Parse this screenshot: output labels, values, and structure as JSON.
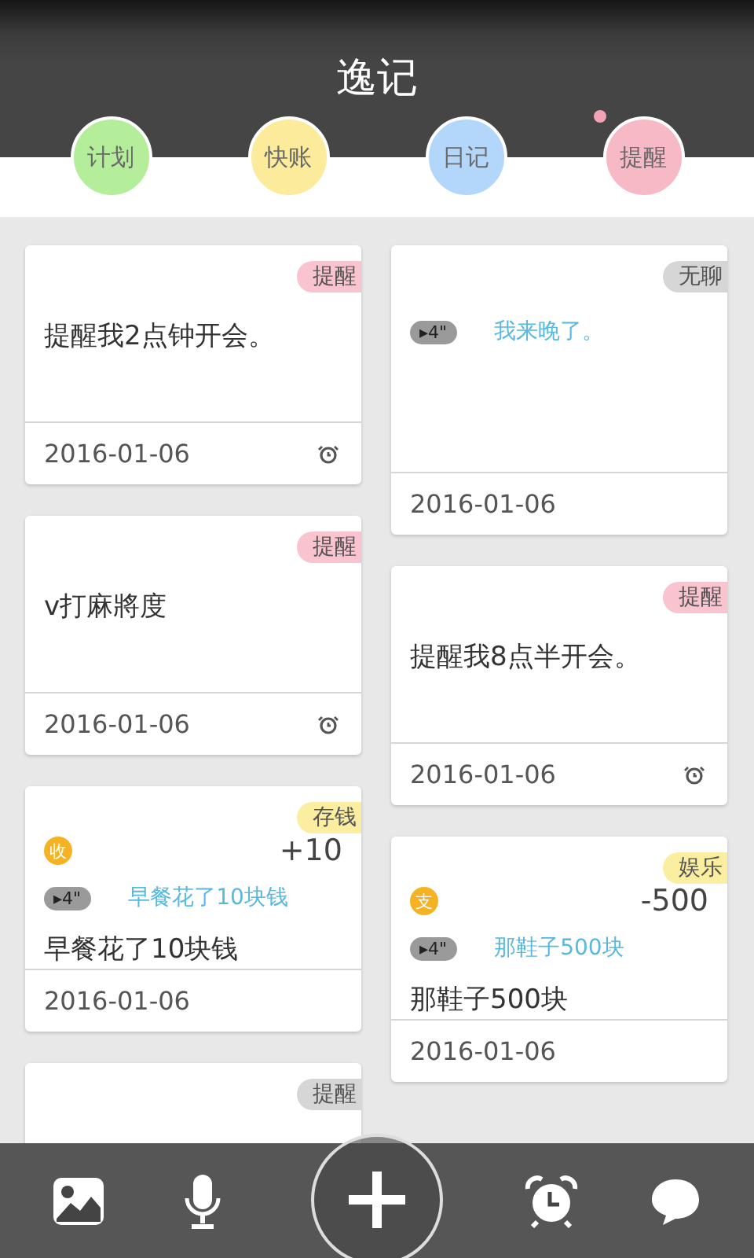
{
  "header": {
    "title": "逸记"
  },
  "categories": [
    {
      "label": "计划",
      "color": "#b5ee9a",
      "unread": false
    },
    {
      "label": "快账",
      "color": "#fbeb9b",
      "unread": false
    },
    {
      "label": "日记",
      "color": "#b3d7fb",
      "unread": false
    },
    {
      "label": "提醒",
      "color": "#f8b9c6",
      "unread": true
    }
  ],
  "columns": [
    {
      "cards": [
        {
          "kind": "text",
          "tag": {
            "label": "提醒",
            "color": "#f9c3d0"
          },
          "text": "提醒我2点钟开会。",
          "date": "2016-01-06",
          "alarm": true
        },
        {
          "kind": "text",
          "tag": {
            "label": "提醒",
            "color": "#f9c3d0"
          },
          "text": "v打麻將度",
          "date": "2016-01-06",
          "alarm": true
        },
        {
          "kind": "money",
          "tag": {
            "label": "存钱",
            "color": "#fbeea0"
          },
          "badge": "收",
          "amount": "+10",
          "voice": "▸4\"",
          "transcript": "早餐花了10块钱",
          "text": "早餐花了10块钱",
          "date": "2016-01-06"
        },
        {
          "kind": "text",
          "tag": {
            "label": "提醒",
            "color": "#d6d6d6"
          }
        }
      ]
    },
    {
      "cards": [
        {
          "kind": "voice",
          "tag": {
            "label": "无聊",
            "color": "#d6d6d6"
          },
          "voice": "▸4\"",
          "transcript": "我来晚了。",
          "date": "2016-01-06"
        },
        {
          "kind": "text",
          "tag": {
            "label": "提醒",
            "color": "#f9c3d0"
          },
          "text": "提醒我8点半开会。",
          "date": "2016-01-06",
          "alarm": true
        },
        {
          "kind": "money",
          "tag": {
            "label": "娱乐",
            "color": "#fbeea0"
          },
          "badge": "支",
          "amount": "-500",
          "voice": "▸4\"",
          "transcript": "那鞋子500块",
          "text": "那鞋子500块",
          "date": "2016-01-06"
        }
      ]
    }
  ]
}
